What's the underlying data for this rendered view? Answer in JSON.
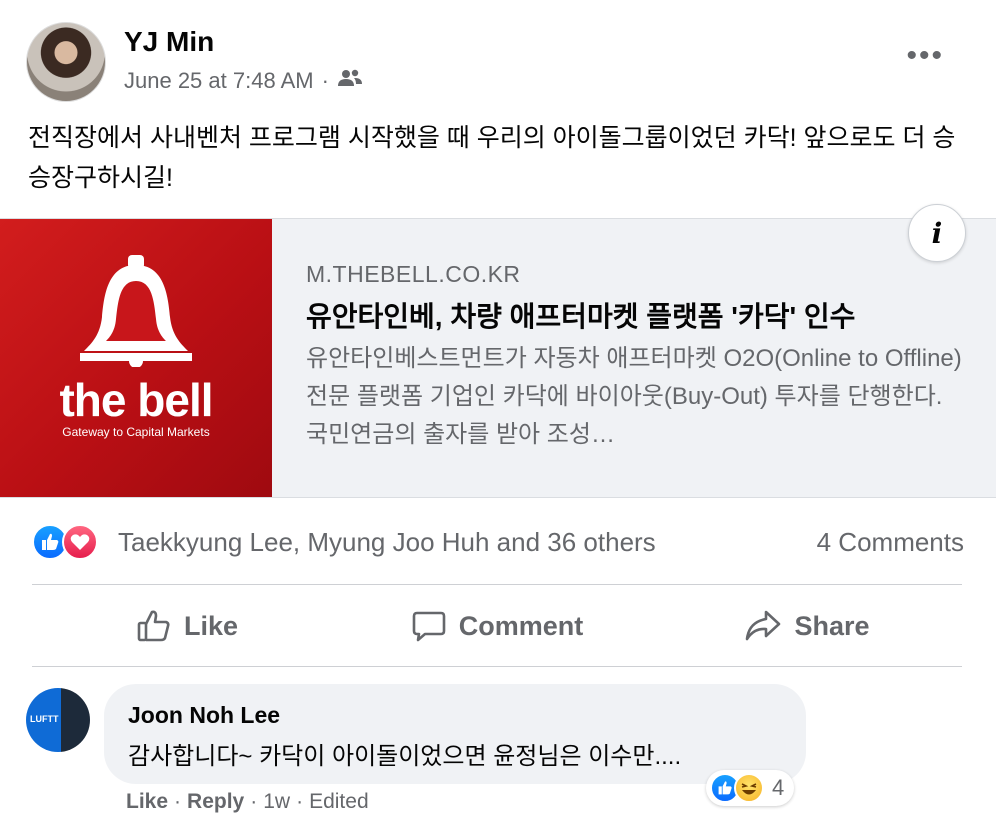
{
  "post": {
    "author": "YJ Min",
    "timestamp": "June 25 at 7:48 AM",
    "separator": "·",
    "audience_icon": "friends-icon",
    "more_label": "•••",
    "text": "전직장에서 사내벤처 프로그램 시작했을 때 우리의 아이돌그룹이었던 카닥! 앞으로도 더 승승장구하시길!"
  },
  "link": {
    "thumb_title": "the bell",
    "thumb_subtitle": "Gateway to Capital Markets",
    "info_label": "i",
    "domain": "M.THEBELL.CO.KR",
    "title": "유안타인베, 차량 애프터마켓 플랫폼 '카닥' 인수",
    "description": "유안타인베스트먼트가 자동차 애프터마켓 O2O(Online to Offline)전문 플랫폼 기업인 카닥에 바이아웃(Buy-Out) 투자를 단행한다. 국민연금의 출자를 받아 조성…"
  },
  "reactions": {
    "names": "Taekkyung Lee, Myung Joo Huh and 36 others",
    "comments_count": "4 Comments"
  },
  "actions": {
    "like": "Like",
    "comment": "Comment",
    "share": "Share"
  },
  "comment": {
    "author": "Joon Noh Lee",
    "avatar_text": "LUFTT",
    "text": "감사합니다~ 카닥이 아이돌이었으면 윤정님은 이수만....",
    "reaction_count": "4",
    "like_label": "Like",
    "reply_label": "Reply",
    "dot": "·",
    "age": "1w",
    "edited": "Edited"
  },
  "colors": {
    "secondary_text": "#65676b",
    "like_blue": "#0a6bff",
    "love_red": "#e61e4d",
    "bell_red": "#c8161b"
  }
}
